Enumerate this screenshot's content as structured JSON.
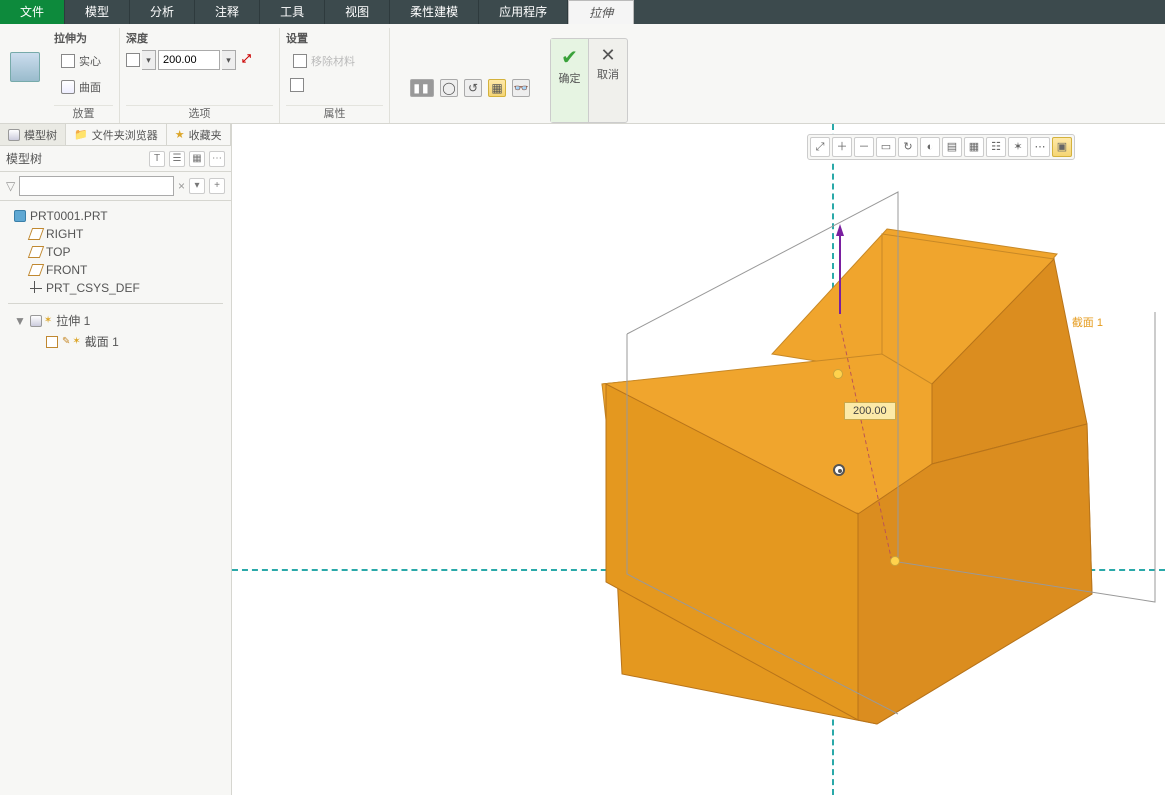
{
  "menu": {
    "file": "文件",
    "model": "模型",
    "analysis": "分析",
    "annotate": "注释",
    "tools": "工具",
    "view": "视图",
    "flex": "柔性建模",
    "apps": "应用程序",
    "extrude": "拉伸"
  },
  "ribbon": {
    "extrude_as": "拉伸为",
    "solid": "实心",
    "surface": "曲面",
    "depth": "深度",
    "depth_value": "200.00",
    "settings": "设置",
    "remove_material": "移除材料",
    "placement": "放置",
    "options": "选项",
    "properties": "属性",
    "ok": "确定",
    "cancel": "取消"
  },
  "side": {
    "tab_tree": "模型树",
    "tab_folder": "文件夹浏览器",
    "tab_fav": "收藏夹",
    "header": "模型树",
    "filter_x": "×",
    "prt": "PRT0001.PRT",
    "right": "RIGHT",
    "top": "TOP",
    "front": "FRONT",
    "csys": "PRT_CSYS_DEF",
    "extrude1": "拉伸 1",
    "section1": "截面 1"
  },
  "viewport": {
    "dim": "200.00",
    "section_label": "截面 1"
  }
}
